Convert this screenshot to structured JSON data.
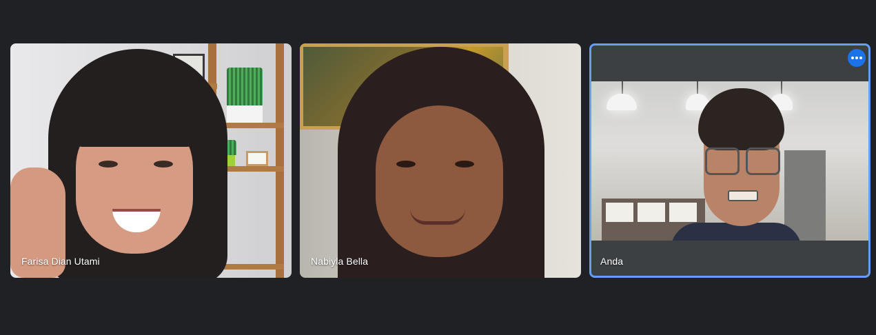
{
  "participants": [
    {
      "name": "Farisa Dian Utami"
    },
    {
      "name": "Nabiyla Bella"
    },
    {
      "name": "Anda"
    }
  ],
  "active_tile": {
    "border_color": "#669df6",
    "more_options_icon": "more-horizontal-icon"
  },
  "colors": {
    "background": "#202124",
    "accent": "#1a73e8"
  }
}
